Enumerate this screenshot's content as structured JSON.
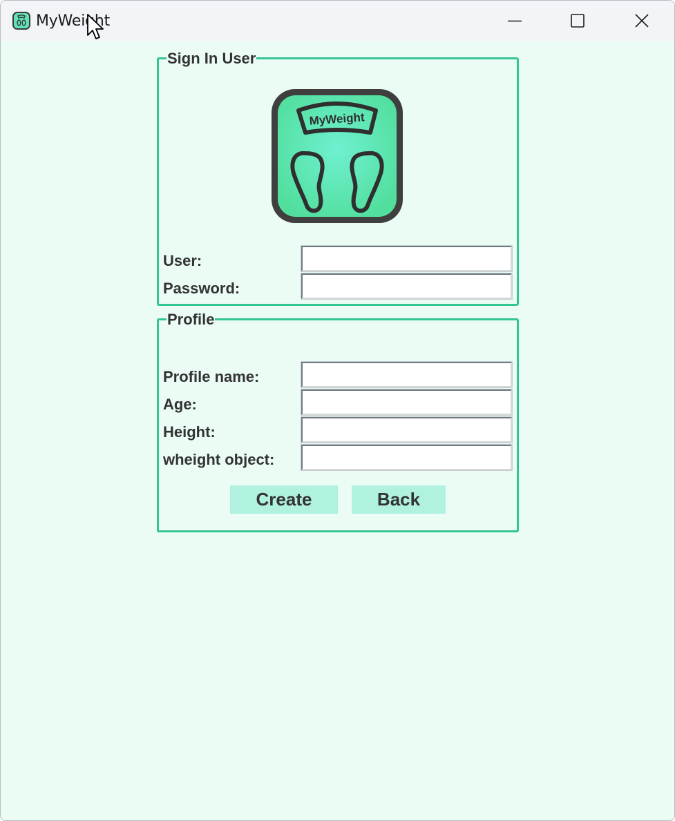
{
  "window": {
    "title": "MyWeight"
  },
  "signin": {
    "legend": "Sign In User",
    "logo_text": "MyWeight",
    "user_label": "User:",
    "user_value": "",
    "password_label": "Password:",
    "password_value": ""
  },
  "profile": {
    "legend": "Profile",
    "profile_name_label": "Profile name:",
    "profile_name_value": "",
    "age_label": "Age:",
    "age_value": "",
    "height_label": "Height:",
    "height_value": "",
    "weight_object_label": "wheight object:",
    "weight_object_value": ""
  },
  "buttons": {
    "create_label": "Create",
    "back_label": "Back"
  },
  "icons": {
    "app": "scale-app-icon",
    "minimize": "minimize-icon",
    "maximize": "maximize-icon",
    "close": "close-icon",
    "cursor": "mouse-pointer-icon"
  },
  "colors": {
    "background": "#ebfcf5",
    "groupbox_border": "#33c593",
    "button_bg": "#b0f2df",
    "text": "#333333",
    "titlebar": "#f2f4f8"
  }
}
